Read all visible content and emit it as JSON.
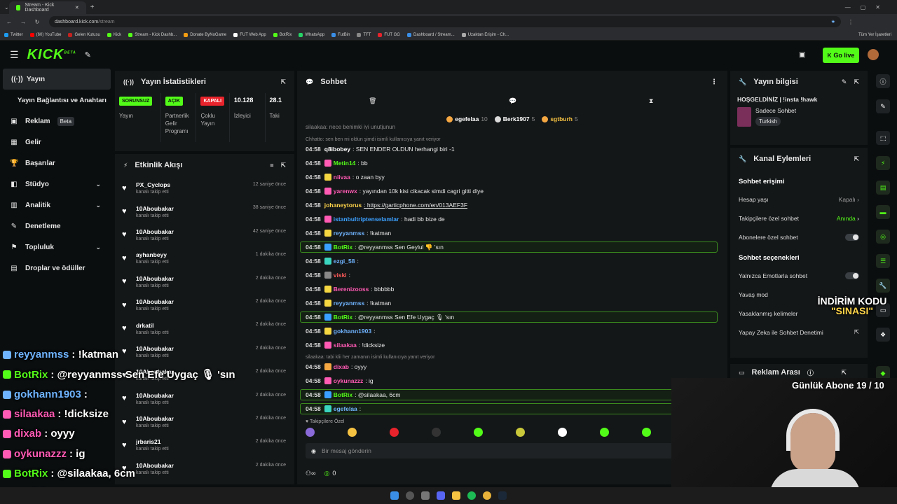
{
  "browser": {
    "tab_title": "Stream - Kick Dashboard",
    "new_tab_symbol": "+",
    "url_host": "dashboard.kick.com",
    "url_path": "/stream",
    "bookmarks": [
      "Twitter",
      "(60) YouTube",
      "Gelen Kutusu",
      "Kick",
      "Stream - Kick Dashb...",
      "Donate ByNoGame",
      "FUT Web App",
      "BotRix",
      "WhatsApp",
      "FutBin",
      "TFT",
      "FUT GG",
      "Dashboard / Stream...",
      "Uzaktan Erişim - Ch..."
    ],
    "all_bookmarks": "Tüm Yer İşaretleri"
  },
  "header": {
    "logo": "KICK",
    "logo_sup": "BETA",
    "go_live": "Go live"
  },
  "sidebar": {
    "items": [
      {
        "label": "Yayın",
        "icon": "((·))"
      },
      {
        "label": "Yayın Bağlantısı ve Anahtarı",
        "icon": ""
      },
      {
        "label": "Reklam",
        "icon": "▣",
        "badge": "Beta"
      },
      {
        "label": "Gelir",
        "icon": "▦"
      },
      {
        "label": "Başarılar",
        "icon": "🏆"
      },
      {
        "label": "Stüdyo",
        "icon": "◧",
        "chevron": "⌄"
      },
      {
        "label": "Analitik",
        "icon": "▥",
        "chevron": "⌄"
      },
      {
        "label": "Denetleme",
        "icon": "✎"
      },
      {
        "label": "Topluluk",
        "icon": "⚑",
        "chevron": "⌄"
      },
      {
        "label": "Droplar ve ödüller",
        "icon": "▤"
      }
    ]
  },
  "stats": {
    "title": "Yayın İstatistikleri",
    "cols": [
      {
        "badge": "SORUNSUZ",
        "label": "Yayın",
        "color": "#53fc18"
      },
      {
        "badge": "AÇIK",
        "label": "Partnerlik Gelir Programı",
        "color": "#53fc18"
      },
      {
        "badge": "KAPALI",
        "label": "Çoklu Yayın",
        "color": "#e8232b"
      },
      {
        "badge": "10.128",
        "label": "İzleyici",
        "color": ""
      },
      {
        "badge": "28.1",
        "label": "Taki",
        "color": ""
      }
    ]
  },
  "activity": {
    "title": "Etkinlik Akışı",
    "sub": "kanalı takip etti",
    "rows": [
      {
        "name": "PX_Cyclops",
        "time": "12 saniye önce"
      },
      {
        "name": "10Aboubakar",
        "time": "38 saniye önce"
      },
      {
        "name": "10Aboubakar",
        "time": "42 saniye önce"
      },
      {
        "name": "ayhanbeyy",
        "time": "1 dakika önce"
      },
      {
        "name": "10Aboubakar",
        "time": "2 dakika önce"
      },
      {
        "name": "10Aboubakar",
        "time": "2 dakika önce"
      },
      {
        "name": "drkatil",
        "time": "2 dakika önce"
      },
      {
        "name": "10Aboubakar",
        "time": "2 dakika önce"
      },
      {
        "name": "10Aboubakar",
        "time": "2 dakika önce"
      },
      {
        "name": "10Aboubakar",
        "time": "2 dakika önce"
      },
      {
        "name": "10Aboubakar",
        "time": "2 dakika önce"
      },
      {
        "name": "jrbaris21",
        "time": "2 dakika önce"
      },
      {
        "name": "10Aboubakar",
        "time": "2 dakika önce"
      }
    ]
  },
  "chat": {
    "title": "Sohbet",
    "top_users": [
      {
        "name": "egefelaa",
        "count": "10"
      },
      {
        "name": "Berk1907",
        "count": "5"
      },
      {
        "name": "sgtburh",
        "count": "5"
      }
    ],
    "cut_top": "silaakaa: nece benimki iyi unutjunun",
    "messages": [
      {
        "type": "reply",
        "text": "Chhatto: sen ben mi oldun şimdi isimli kullanıcıya yanıt veriyor"
      },
      {
        "type": "msg",
        "time": "04:58",
        "user": "q8ibobey",
        "color": "#ffffff",
        "text": ": SEN ENDER OLDUN herhangi biri -1",
        "badge": ""
      },
      {
        "type": "msg",
        "time": "04:58",
        "user": "Metin14",
        "color": "#53fc18",
        "text": ": bb",
        "badge": "#ff5ab4"
      },
      {
        "type": "msg",
        "time": "04:58",
        "user": "niivaa",
        "color": "#ff5ab4",
        "text": ": o zaan byy",
        "badge": "#f5d742"
      },
      {
        "type": "msg",
        "time": "04:58",
        "user": "yarenwx",
        "color": "#ff5ab4",
        "text": ": yayından 10k kisi cikacak simdi cagri gitti diye",
        "badge": "#ff5ab4"
      },
      {
        "type": "msg",
        "time": "04:58",
        "user": "johaneytorus",
        "color": "#ffd54a",
        "text": ": https://garticphone.com/en/013AEF3F",
        "badge": ""
      },
      {
        "type": "msg",
        "time": "04:58",
        "user": "istanbultriptenselamlar",
        "color": "#3aa0ff",
        "text": ": hadi bb bize de",
        "badge": "#ff5ab4"
      },
      {
        "type": "msg",
        "time": "04:58",
        "user": "reyyanmss",
        "color": "#6fb4ff",
        "text": ": !katman",
        "badge": "#f5d742"
      },
      {
        "type": "hl",
        "time": "04:58",
        "user": "BotRix",
        "color": "#53fc18",
        "text": ": @reyyanmss Sen Geylul 👎 'sın",
        "badge": "#3aa0ff"
      },
      {
        "type": "msg",
        "time": "04:58",
        "user": "ezgi_58",
        "color": "#6fb4ff",
        "text": ":",
        "badge": "#3ad6c0"
      },
      {
        "type": "msg",
        "time": "04:58",
        "user": "viski",
        "color": "#ff5a5a",
        "text": ":",
        "badge": "#888888"
      },
      {
        "type": "msg",
        "time": "04:58",
        "user": "Berenizooss",
        "color": "#ff5ab4",
        "text": ": bbbbbb",
        "badge": "#f5d742"
      },
      {
        "type": "msg",
        "time": "04:58",
        "user": "reyyanmss",
        "color": "#6fb4ff",
        "text": ": !katman",
        "badge": "#f5d742"
      },
      {
        "type": "hl",
        "time": "04:58",
        "user": "BotRix",
        "color": "#53fc18",
        "text": ": @reyyanmss Sen Efe Uygaç 🎙 'sın",
        "badge": "#3aa0ff"
      },
      {
        "type": "msg",
        "time": "04:58",
        "user": "gokhann1903",
        "color": "#6fb4ff",
        "text": ":",
        "badge": "#f5d742"
      },
      {
        "type": "msg",
        "time": "04:58",
        "user": "silaakaa",
        "color": "#ff5ab4",
        "text": ": !dicksize",
        "badge": "#ff5ab4"
      },
      {
        "type": "reply",
        "text": "silaakaa: tabi klii her zamanın isimli kullanıcıya yanıt veriyor"
      },
      {
        "type": "msg",
        "time": "04:58",
        "user": "dixab",
        "color": "#ff5ab4",
        "text": ": oyyy",
        "badge": "#f5a742"
      },
      {
        "type": "msg",
        "time": "04:58",
        "user": "oykunazzz",
        "color": "#ff5ab4",
        "text": ": ig",
        "badge": "#ff5ab4"
      },
      {
        "type": "hl",
        "time": "04:58",
        "user": "BotRix",
        "color": "#53fc18",
        "text": ": @silaakaa, 6cm",
        "badge": "#3aa0ff"
      },
      {
        "type": "hl",
        "time": "04:58",
        "user": "egefelaa",
        "color": "#6fb4ff",
        "text": ":",
        "badge": "#3ad6c0"
      }
    ],
    "followers_label": "Takipçilere Özel",
    "input_placeholder": "Bir mesaj gönderin",
    "bottom_count": "0"
  },
  "right": {
    "stream_info_title": "Yayın bilgisi",
    "stream_title": "HOŞGELDİNİZ | !insta !hawk",
    "category": "Sadece Sohbet",
    "language": "Turkish",
    "channel_actions_title": "Kanal Eylemleri",
    "chat_access": "Sohbet erişimi",
    "age_limit": "Hesap yaşı",
    "age_limit_value": "Kapalı",
    "followers_chat": "Takipçilere özel sohbet",
    "followers_chat_value": "Anında",
    "subs_chat": "Abonelere özel sohbet",
    "chat_options": "Sohbet seçenekleri",
    "emote_only": "Yalnızca Emotlarla sohbet",
    "slow_mode": "Yavaş mod",
    "banned_words": "Yasaklanmış kelimeler",
    "ai_moderation": "Yapay Zeka ile Sohbet Denetimi",
    "ads_title": "Reklam Arası"
  },
  "overlay": {
    "discount_line1": "İNDİRİM KODU",
    "discount_line2": "\"SINASI\"",
    "daily_subs": "Günlük Abone 19 / 10",
    "chat": [
      {
        "user": "reyyanmss",
        "text": ": !katman",
        "color": "#6fb4ff"
      },
      {
        "user": "BotRix",
        "text": ": @reyyanmss Sen Efe Uygaç 🎙 'sın",
        "color": "#53fc18"
      },
      {
        "user": "gokhann1903",
        "text": " :",
        "color": "#6fb4ff"
      },
      {
        "user": "silaakaa",
        "text": " : !dicksize",
        "color": "#ff5ab4"
      },
      {
        "user": "dixab",
        "text": " : oyyy",
        "color": "#ff5ab4"
      },
      {
        "user": "oykunazzz",
        "text": " : ig",
        "color": "#ff5ab4"
      },
      {
        "user": "BotRix",
        "text": ": @silaakaa, 6cm",
        "color": "#53fc18"
      },
      {
        "user": "egefelaa",
        "text": " :",
        "color": "#53fc18"
      }
    ]
  },
  "colors": {
    "accent": "#53fc18",
    "panel": "#141718",
    "bg": "#0b0e0f"
  }
}
